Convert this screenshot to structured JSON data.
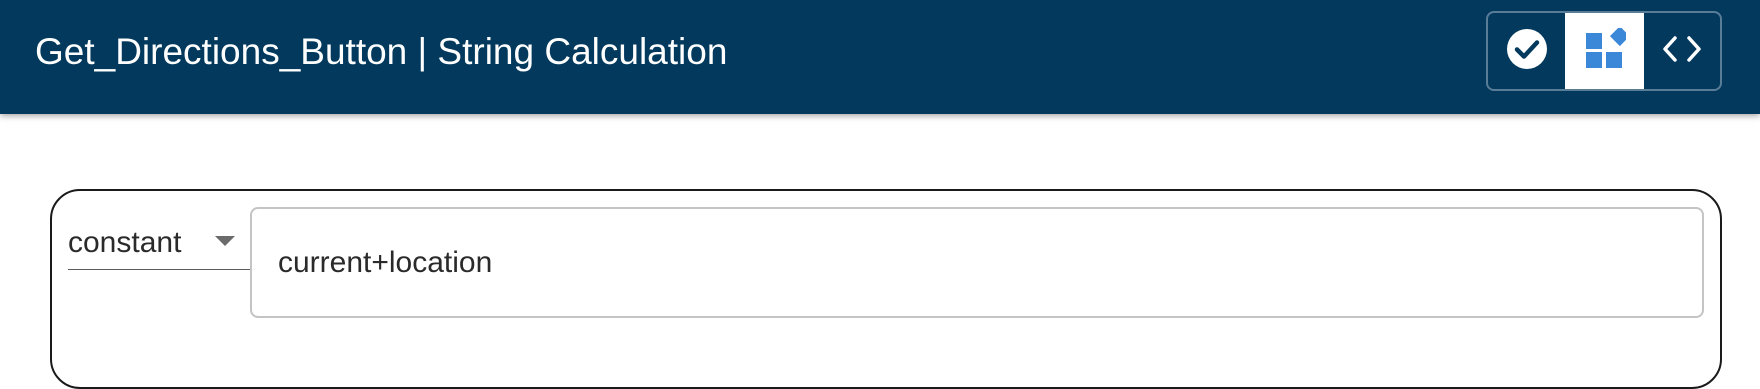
{
  "header": {
    "title": "Get_Directions_Button | String Calculation",
    "background_color": "#02395d",
    "view_toggles": [
      {
        "icon": "check-circle-icon",
        "active": false
      },
      {
        "icon": "blocks-icon",
        "active": true,
        "icon_color": "#3b87d8"
      },
      {
        "icon": "code-icon",
        "active": false
      }
    ]
  },
  "editor": {
    "type_select": {
      "selected": "constant"
    },
    "value_input": {
      "value": "current+location"
    }
  }
}
